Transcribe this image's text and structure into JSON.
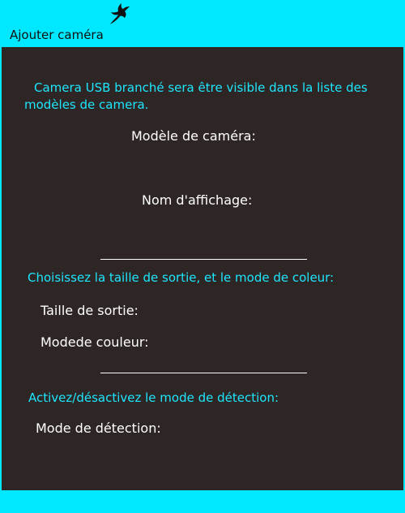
{
  "window": {
    "title": "Ajouter caméra",
    "logo_icon": "eagle-icon"
  },
  "info": {
    "text": "Camera USB branché sera être visible dans la liste des modèles de camera."
  },
  "camera": {
    "model_label": "Modèle de caméra:",
    "display_name_label": "Nom d'affichage:"
  },
  "output": {
    "heading": "Choisissez la taille de sortie, et le mode de coleur:",
    "size_label": "Taille de sortie:",
    "color_mode_label": "Modede couleur:"
  },
  "detection": {
    "heading": "Activez/désactivez le mode de détection:",
    "mode_label": "Mode de détection:"
  },
  "colors": {
    "accent": "#00e8ff",
    "panel": "#2e2624",
    "heading_text": "#1ee6ff",
    "label_text": "#ffffff"
  }
}
